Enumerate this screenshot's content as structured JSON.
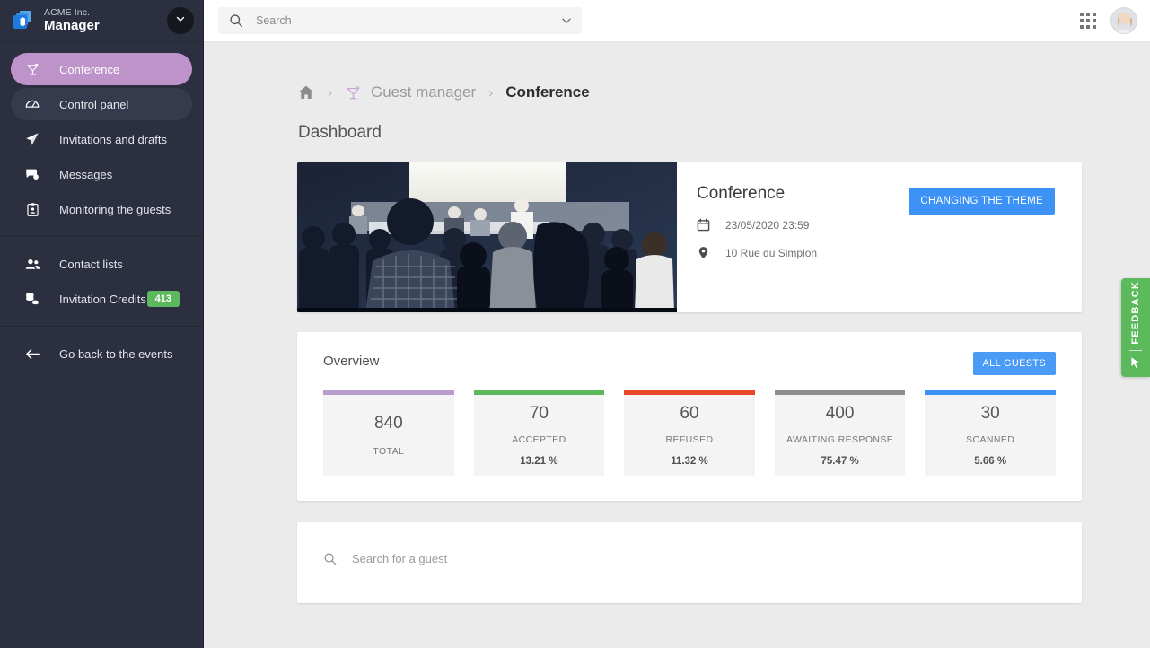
{
  "sidebar": {
    "brand": {
      "company": "ACME Inc.",
      "title": "Manager",
      "logo_icon": "cube-logo-icon",
      "toggle_icon": "chevron-down-icon"
    },
    "groups": [
      {
        "items": [
          {
            "label": "Conference",
            "icon": "cocktail-glass-icon",
            "state": "active"
          },
          {
            "label": "Control panel",
            "icon": "dashboard-gauge-icon",
            "state": "subtle"
          },
          {
            "label": "Invitations and drafts",
            "icon": "paper-plane-icon",
            "state": "default"
          },
          {
            "label": "Messages",
            "icon": "chat-bubbles-icon",
            "state": "default"
          },
          {
            "label": "Monitoring the guests",
            "icon": "clipboard-user-icon",
            "state": "default"
          }
        ]
      },
      {
        "items": [
          {
            "label": "Contact lists",
            "icon": "people-icon",
            "state": "default"
          },
          {
            "label": "Invitation Credits",
            "icon": "coins-stack-icon",
            "state": "default",
            "badge": "413"
          }
        ]
      },
      {
        "items": [
          {
            "label": "Go back to the events",
            "icon": "arrow-left-icon",
            "state": "default"
          }
        ]
      }
    ]
  },
  "topbar": {
    "search": {
      "value": "",
      "placeholder": "Search",
      "icon": "search-icon",
      "chevron": "chevron-down-icon"
    },
    "apps_icon": "apps-grid-icon",
    "avatar": "user-avatar"
  },
  "breadcrumb": {
    "home_icon": "home-icon",
    "separator": "›",
    "items": [
      {
        "label": "Guest manager",
        "icon": "cocktail-glass-icon"
      }
    ],
    "current": "Conference"
  },
  "page": {
    "title": "Dashboard"
  },
  "event": {
    "name": "Conference",
    "theme_button": "CHANGING THE THEME",
    "date": "23/05/2020 23:59",
    "date_icon": "calendar-icon",
    "location": "10 Rue du Simplon",
    "location_icon": "map-pin-icon",
    "photo_alt": "conference-audience-photo"
  },
  "overview": {
    "title": "Overview",
    "all_guests_button": "ALL GUESTS",
    "stats": [
      {
        "value": "840",
        "label": "TOTAL",
        "pct": "",
        "color": "#b89cce"
      },
      {
        "value": "70",
        "label": "ACCEPTED",
        "pct": "13.21 %",
        "color": "#5cb85c"
      },
      {
        "value": "60",
        "label": "REFUSED",
        "pct": "11.32 %",
        "color": "#e8472a"
      },
      {
        "value": "400",
        "label": "AWAITING RESPONSE",
        "pct": "75.47 %",
        "color": "#8d8d8d"
      },
      {
        "value": "30",
        "label": "SCANNED",
        "pct": "5.66 %",
        "color": "#3d93f5"
      }
    ]
  },
  "guest_search": {
    "value": "",
    "placeholder": "Search for a guest",
    "icon": "search-icon"
  },
  "feedback": {
    "label": "FEEDBACK",
    "icon": "cursor-pointer-icon",
    "color": "#5cba5c"
  },
  "colors": {
    "sidebar_bg": "#2b2f3f",
    "active_nav": "#bd93c9",
    "accent_blue": "#3d93f5",
    "badge_green": "#5cb85c",
    "page_bg": "#ebebeb"
  }
}
